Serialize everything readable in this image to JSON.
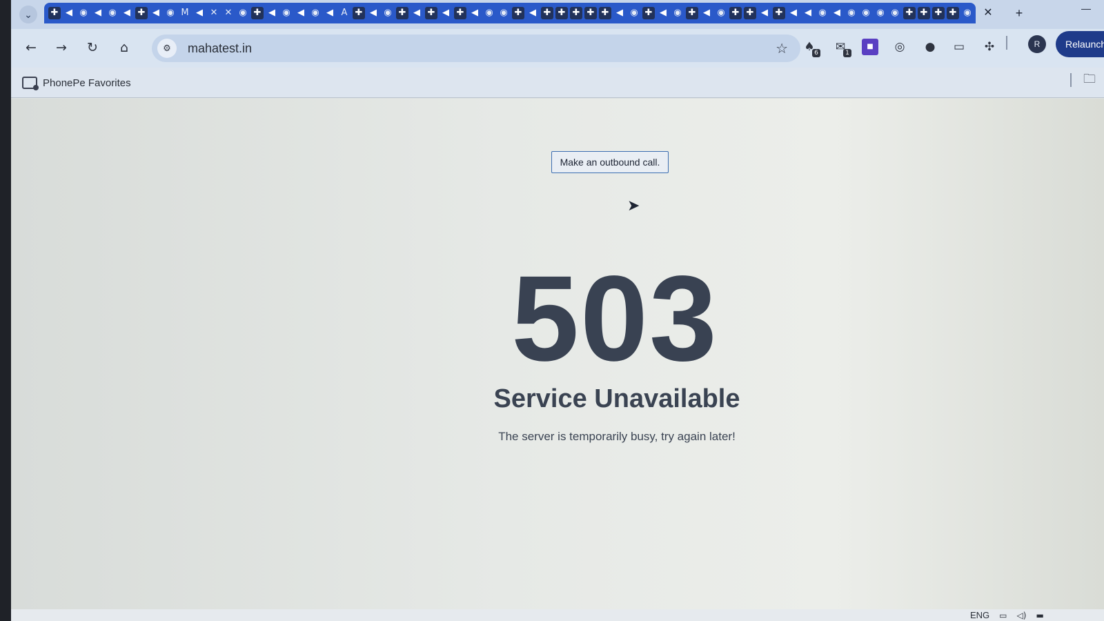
{
  "browser": {
    "tab_strip": {
      "search_tabs_icon": "chevron-down-icon",
      "tabs": [
        "plus",
        "fish",
        "circle",
        "fish",
        "circle",
        "fish",
        "plus",
        "fish",
        "circle",
        "M",
        "fish",
        "x",
        "x",
        "circle",
        "plus",
        "fish",
        "circle",
        "fish",
        "circle",
        "fish",
        "A",
        "plus",
        "fish",
        "circle",
        "plus",
        "fish",
        "plus",
        "fish",
        "plus",
        "fish",
        "circle",
        "circle",
        "plus",
        "fish",
        "plus",
        "plus",
        "plus",
        "plus",
        "plus",
        "fish",
        "circle",
        "plus",
        "fish",
        "circle",
        "plus",
        "fish",
        "circle",
        "plus",
        "plus",
        "fish",
        "plus",
        "fish",
        "fish",
        "circle",
        "fish",
        "circle",
        "circle",
        "circle",
        "circle",
        "plus",
        "plus",
        "plus",
        "plus",
        "circle",
        "plus",
        "fish"
      ],
      "close_label": "✕",
      "new_tab_label": "+",
      "minimize_label": "—"
    },
    "toolbar": {
      "back_icon": "←",
      "forward_icon": "→",
      "reload_icon": "↻",
      "home_icon": "⌂",
      "site_info_icon": "⚙",
      "url": "mahatest.in",
      "bookmark_icon": "☆",
      "extensions": [
        {
          "name": "extension-1-icon",
          "glyph": "♠",
          "badge": "6"
        },
        {
          "name": "extension-2-icon",
          "glyph": "✉",
          "badge": "1"
        },
        {
          "name": "extension-3-icon",
          "glyph": "■",
          "badge": ""
        },
        {
          "name": "extension-4-icon",
          "glyph": "◎",
          "badge": ""
        },
        {
          "name": "extension-5-icon",
          "glyph": "●",
          "badge": ""
        },
        {
          "name": "extension-6-icon",
          "glyph": "▭",
          "badge": ""
        },
        {
          "name": "extensions-menu-icon",
          "glyph": "✣",
          "badge": ""
        }
      ],
      "profile_initial": "R",
      "relaunch_label": "Relaunch"
    },
    "bookmarks_bar": {
      "items": [
        {
          "label": "PhonePe Favorites"
        }
      ],
      "folder_icon": "🗀"
    }
  },
  "page": {
    "outbound_call_button": "Make an outbound call.",
    "error_code": "503",
    "error_title": "Service Unavailable",
    "error_message": "The server is temporarily busy, try again later!"
  },
  "taskbar": {
    "language": "ENG",
    "tray_icons": [
      "network-icon",
      "volume-icon",
      "battery-icon"
    ]
  }
}
